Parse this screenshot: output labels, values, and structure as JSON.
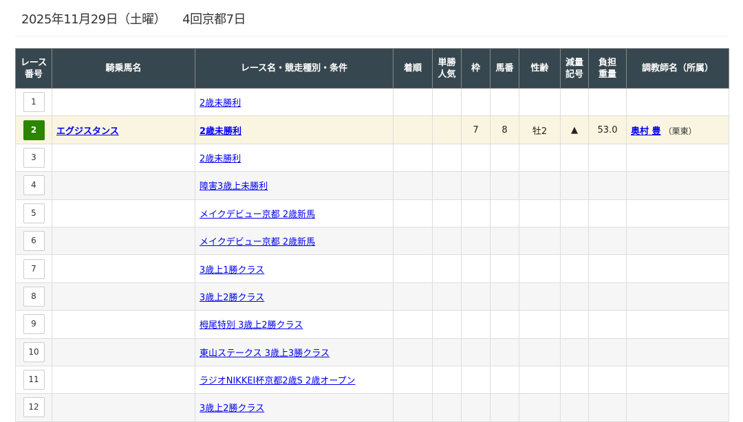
{
  "header": {
    "date": "2025年11月29日（土曜）",
    "meeting": "4回京都7日"
  },
  "columns": [
    "レース\n番号",
    "騎乗馬名",
    "レース名・競走種別・条件",
    "着順",
    "単勝\n人気",
    "枠",
    "馬番",
    "性齢",
    "減量\n記号",
    "負担\n重量",
    "調教師名（所属）"
  ],
  "rows": [
    {
      "no": "1",
      "horse": "",
      "race": "2歳未勝利",
      "rank": "",
      "pop": "",
      "waku": "",
      "umaban": "",
      "sexage": "",
      "mark": "",
      "weight": "",
      "trainer": "",
      "belong": ""
    },
    {
      "no": "2",
      "horse": "エグジスタンス",
      "race": "2歳未勝利",
      "rank": "",
      "pop": "",
      "waku": "7",
      "umaban": "8",
      "sexage": "牡2",
      "mark": "▲",
      "weight": "53.0",
      "trainer": "奥村 豊",
      "belong": "（栗東）",
      "active": true
    },
    {
      "no": "3",
      "horse": "",
      "race": "2歳未勝利"
    },
    {
      "no": "4",
      "horse": "",
      "race": "障害3歳上未勝利"
    },
    {
      "no": "5",
      "horse": "",
      "race": "メイクデビュー京都 2歳新馬"
    },
    {
      "no": "6",
      "horse": "",
      "race": "メイクデビュー京都 2歳新馬"
    },
    {
      "no": "7",
      "horse": "",
      "race": "3歳上1勝クラス"
    },
    {
      "no": "8",
      "horse": "",
      "race": "3歳上2勝クラス"
    },
    {
      "no": "9",
      "horse": "",
      "race": "栂尾特別 3歳上2勝クラス"
    },
    {
      "no": "10",
      "horse": "",
      "race": "東山ステークス 3歳上3勝クラス"
    },
    {
      "no": "11",
      "horse": "",
      "race": "ラジオNIKKEI杯京都2歳S 2歳オープン"
    },
    {
      "no": "12",
      "horse": "",
      "race": "3歳上2勝クラス"
    }
  ]
}
